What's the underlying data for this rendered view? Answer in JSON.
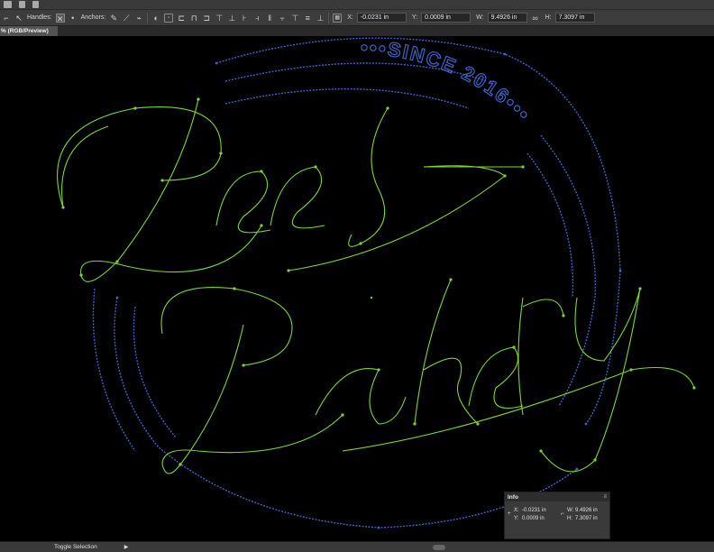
{
  "control_bar": {
    "handles_label": "Handles:",
    "anchors_label": "Anchors:",
    "x_label": "X:",
    "x_value": "-0.0231 in",
    "y_label": "Y:",
    "y_value": "0.0009 in",
    "w_label": "W:",
    "w_value": "9.4926 in",
    "h_label": "H:",
    "h_value": "7.3097 in"
  },
  "document_tab": {
    "label": "% (RGB/Preview)"
  },
  "artwork": {
    "line1": "Bees",
    "line2": "Bakery",
    "since_text": "•••SINCE 2016•••",
    "path_color": "#7cd82a",
    "ring_color": "#3d63c6"
  },
  "info_panel": {
    "title": "Info",
    "x_label": "X:",
    "x_value": "-0.0231 in",
    "y_label": "Y:",
    "y_value": "0.0009 in",
    "w_label": "W:",
    "w_value": "9.4926 in",
    "h_label": "H:",
    "h_value": "7.3097 in"
  },
  "status_bar": {
    "label": "Toggle Selection"
  }
}
